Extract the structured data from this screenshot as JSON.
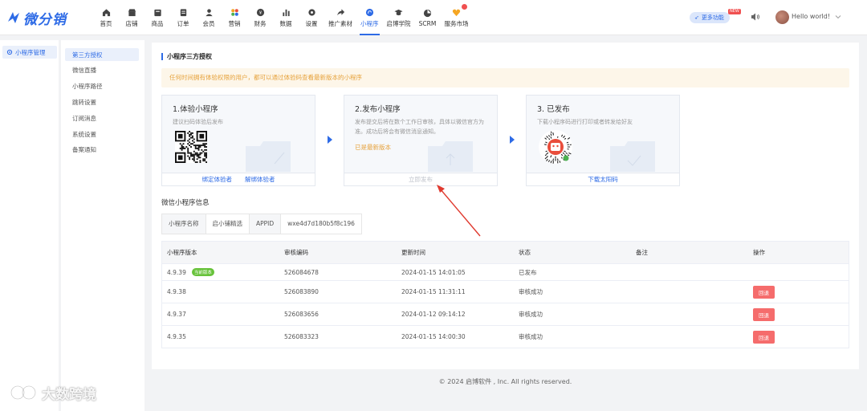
{
  "brand": {
    "name": "微分销"
  },
  "nav": [
    {
      "label": "首页",
      "icon": "home-icon"
    },
    {
      "label": "店铺",
      "icon": "store-icon"
    },
    {
      "label": "商品",
      "icon": "goods-icon"
    },
    {
      "label": "订单",
      "icon": "order-icon"
    },
    {
      "label": "会员",
      "icon": "member-icon"
    },
    {
      "label": "营销",
      "icon": "marketing-icon"
    },
    {
      "label": "财务",
      "icon": "finance-icon"
    },
    {
      "label": "数据",
      "icon": "data-icon"
    },
    {
      "label": "设置",
      "icon": "settings-icon"
    },
    {
      "label": "推广素材",
      "icon": "share-icon"
    },
    {
      "label": "小程序",
      "icon": "miniprogram-icon"
    },
    {
      "label": "启博学院",
      "icon": "academy-icon"
    },
    {
      "label": "SCRM",
      "icon": "scrm-icon"
    },
    {
      "label": "服务市场",
      "icon": "market-icon"
    }
  ],
  "active_nav": "小程序",
  "header": {
    "more_label": "更多功能",
    "new_badge": "NEW",
    "user_name": "Hello world!"
  },
  "side_primary": {
    "label": "小程序管理"
  },
  "side_secondary": [
    {
      "label": "第三方授权"
    },
    {
      "label": "微信直播"
    },
    {
      "label": "小程序路径"
    },
    {
      "label": "跳转设置"
    },
    {
      "label": "订阅消息"
    },
    {
      "label": "系统设置"
    },
    {
      "label": "备案通知"
    }
  ],
  "page": {
    "title": "小程序三方授权",
    "notice": "任何时间拥有体验权限的用户，都可以通过体验码查看最新版本的小程序"
  },
  "steps": [
    {
      "title": "1.体验小程序",
      "desc": "建议扫码体验后发布",
      "links": [
        "绑定体验者",
        "解绑体验者"
      ]
    },
    {
      "title": "2.发布小程序",
      "desc": "发布提交后将在数个工作日审核，具体以微信官方为准。成功后将会有微信消息通知。",
      "status": "已是最新版本",
      "button": "立即发布"
    },
    {
      "title": "3. 已发布",
      "desc": "下载小程序码进行打印或者转发给好友",
      "link": "下载太阳码"
    }
  ],
  "info": {
    "title": "微信小程序信息",
    "name_label": "小程序名称",
    "name_value": "启小铺精选",
    "appid_label": "APPID",
    "appid_value": "wxe4d7d180b5f8c196"
  },
  "table": {
    "headers": [
      "小程序版本",
      "审核编码",
      "更新时间",
      "状态",
      "备注",
      "操作"
    ],
    "current_tag": "当前版本",
    "rollback_label": "回退",
    "rows": [
      {
        "version": "4.9.39",
        "code": "526084678",
        "time": "2024-01-15 14:01:05",
        "status": "已发布",
        "note": "",
        "current": true,
        "action": false
      },
      {
        "version": "4.9.38",
        "code": "526083890",
        "time": "2024-01-15 11:31:11",
        "status": "审核成功",
        "note": "",
        "current": false,
        "action": true
      },
      {
        "version": "4.9.37",
        "code": "526083656",
        "time": "2024-01-12 09:14:12",
        "status": "审核成功",
        "note": "",
        "current": false,
        "action": true
      },
      {
        "version": "4.9.35",
        "code": "526083323",
        "time": "2024-01-15 14:00:30",
        "status": "审核成功",
        "note": "",
        "current": false,
        "action": true
      }
    ]
  },
  "footer": "© 2024 启博软件 , Inc. All rights reserved.",
  "watermark": "大数跨境",
  "colors": {
    "primary": "#2e6be6",
    "warning": "#e6a23c",
    "success": "#67c23a",
    "danger": "#f56c6c",
    "annotation": "#e03a2f"
  }
}
